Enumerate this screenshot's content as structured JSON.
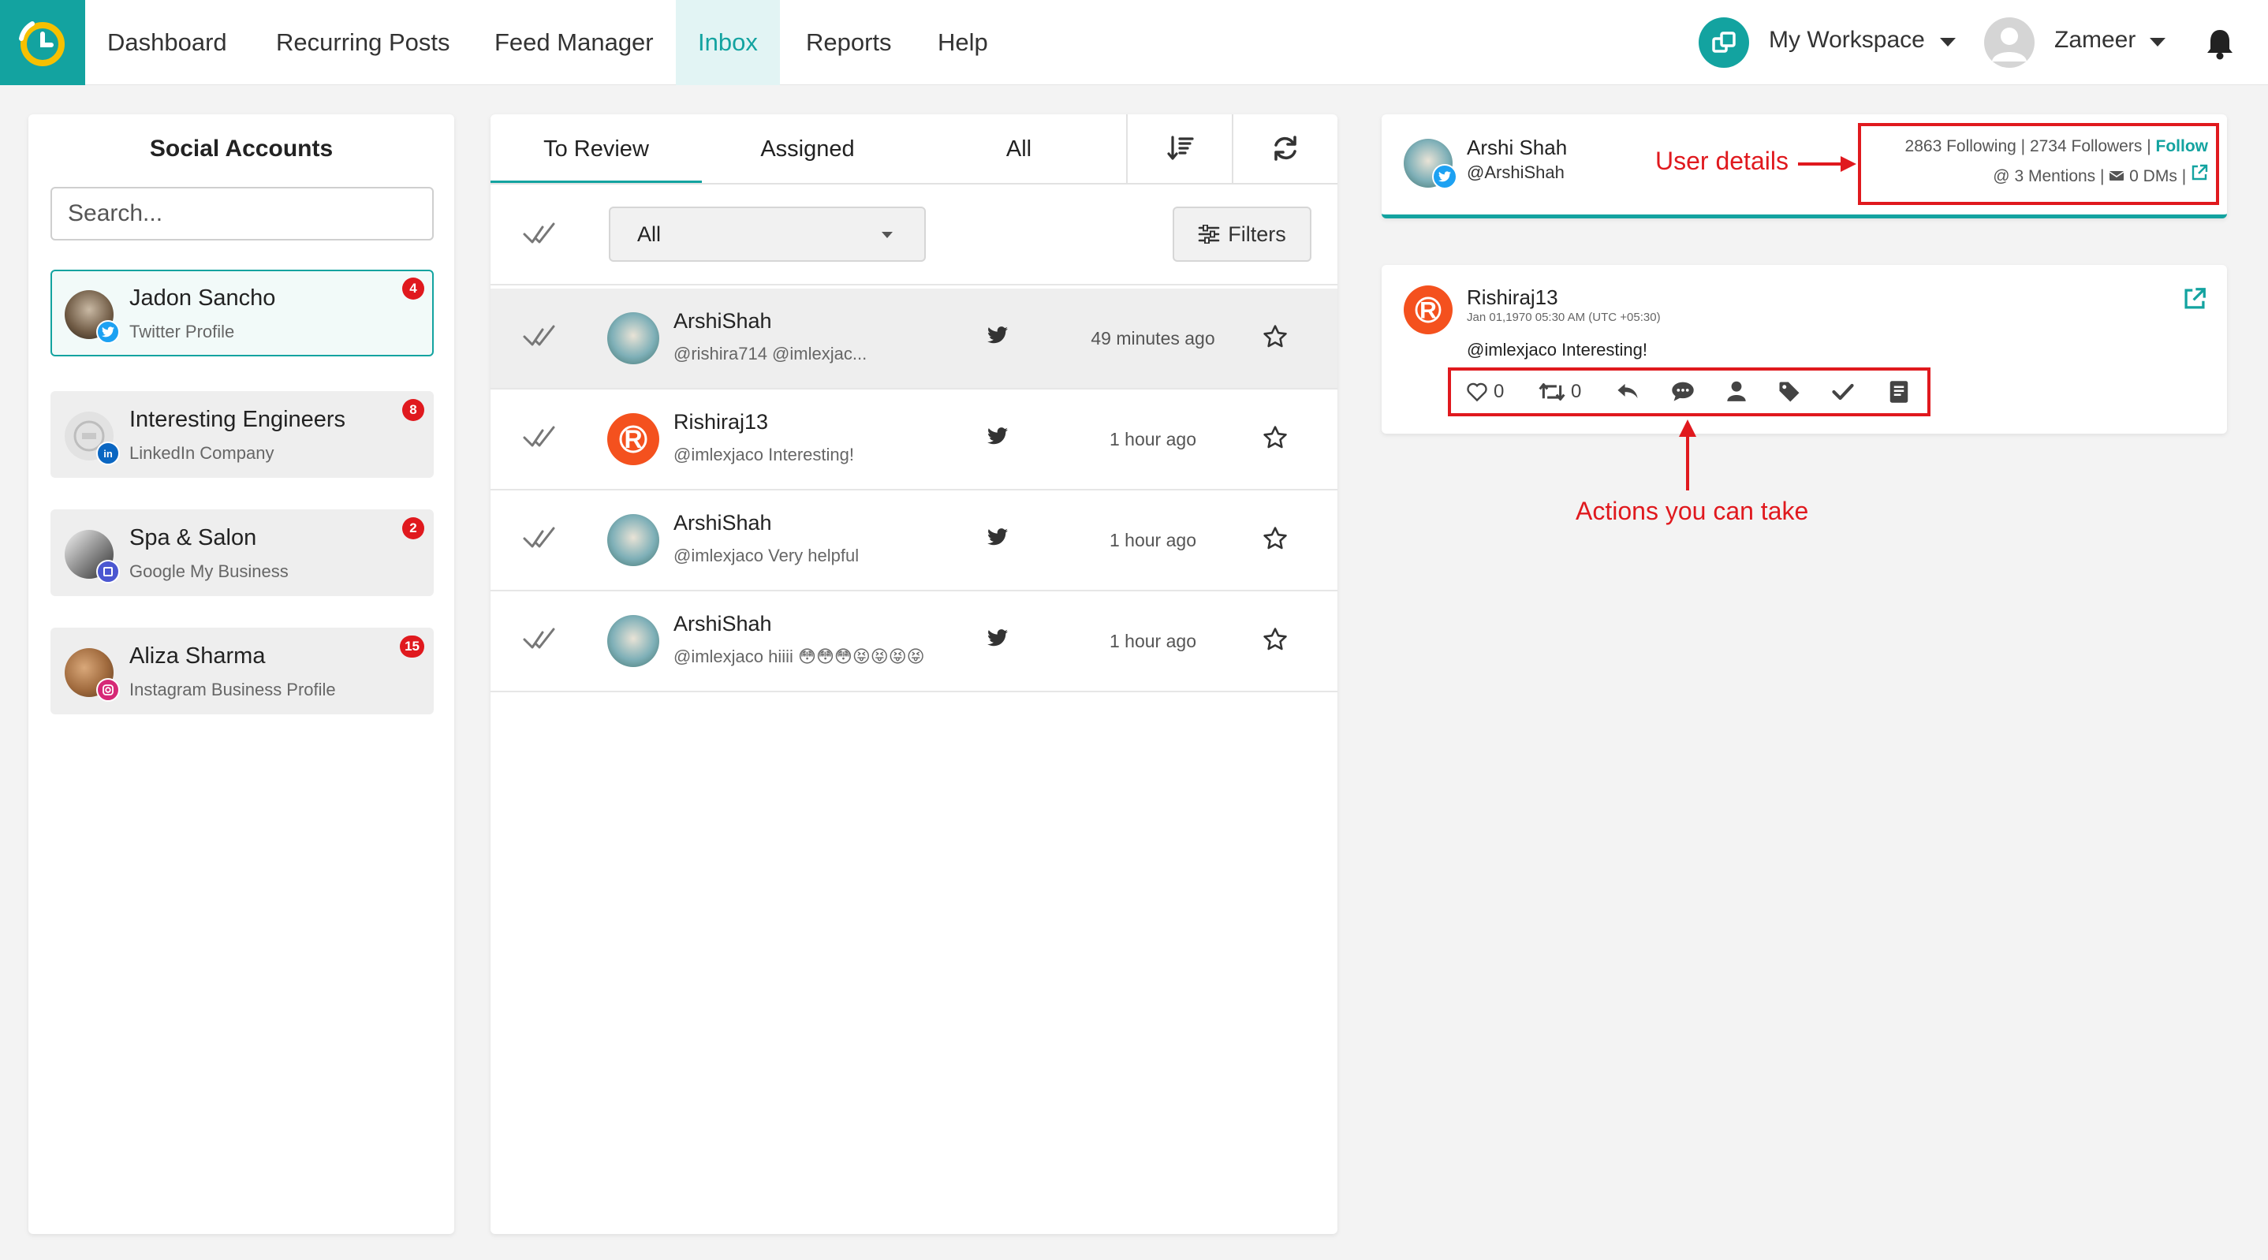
{
  "colors": {
    "accent": "#13a3a0",
    "alert": "#e0191e",
    "twitter": "#1da1f2",
    "linkedin": "#0a66c2",
    "gmb": "#4b57d1",
    "instagram": "#d62976"
  },
  "nav": {
    "items": [
      "Dashboard",
      "Recurring Posts",
      "Feed Manager",
      "Inbox",
      "Reports",
      "Help"
    ],
    "active": "Inbox",
    "workspace": "My Workspace",
    "user": "Zameer",
    "icons": {
      "logo": "clock-logo-icon",
      "workspace": "workspace-icon",
      "notifications": "bell-icon"
    }
  },
  "social_accounts": {
    "title": "Social Accounts",
    "search_placeholder": "Search...",
    "items": [
      {
        "name": "Jadon Sancho",
        "type": "Twitter Profile",
        "badge": "4",
        "network": "twitter"
      },
      {
        "name": "Interesting Engineers",
        "type": "LinkedIn Company",
        "badge": "8",
        "network": "linkedin"
      },
      {
        "name": "Spa & Salon",
        "type": "Google My Business",
        "badge": "2",
        "network": "gmb"
      },
      {
        "name": "Aliza Sharma",
        "type": "Instagram Business Profile",
        "badge": "15",
        "network": "instagram"
      }
    ]
  },
  "inbox": {
    "tabs": [
      "To Review",
      "Assigned",
      "All"
    ],
    "active_tab": "To Review",
    "filter_select": "All",
    "filters_label": "Filters",
    "rows": [
      {
        "name": "ArshiShah",
        "text": "@rishira714 @imlexjac...",
        "time": "49 minutes ago",
        "network": "twitter"
      },
      {
        "name": "Rishiraj13",
        "text": "@imlexjaco Interesting!",
        "time": "1 hour ago",
        "network": "twitter"
      },
      {
        "name": "ArshiShah",
        "text": "@imlexjaco Very helpful",
        "time": "1 hour ago",
        "network": "twitter"
      },
      {
        "name": "ArshiShah",
        "text": "@imlexjaco hiiii 😳😳😳😝😝😝😝",
        "time": "1 hour ago",
        "network": "twitter"
      }
    ]
  },
  "user_details": {
    "name": "Arshi Shah",
    "handle": "@ArshiShah",
    "following": "2863 Following",
    "followers": "2734 Followers",
    "follow_label": "Follow",
    "mentions": "3 Mentions",
    "dms": "0 DMs",
    "annotation": "User details"
  },
  "post": {
    "author": "Rishiraj13",
    "date": "Jan 01,1970 05:30 AM (UTC +05:30)",
    "text": "@imlexjaco Interesting!",
    "likes": "0",
    "retweets": "0",
    "annotation": "Actions you can take"
  }
}
